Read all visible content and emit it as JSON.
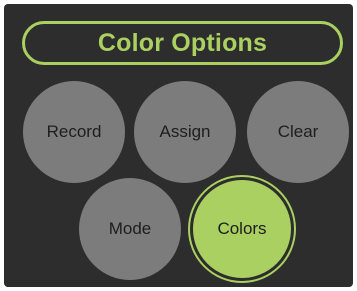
{
  "header": {
    "title": "Color Options"
  },
  "buttons": {
    "record": "Record",
    "assign": "Assign",
    "clear": "Clear",
    "mode": "Mode",
    "colors": "Colors"
  },
  "colors": {
    "accent": "#a9d060",
    "panel_background": "#2d2d2d",
    "button_gray": "#7c7c7c",
    "button_text": "#1e1e1e"
  },
  "state": {
    "selected_button": "colors"
  }
}
